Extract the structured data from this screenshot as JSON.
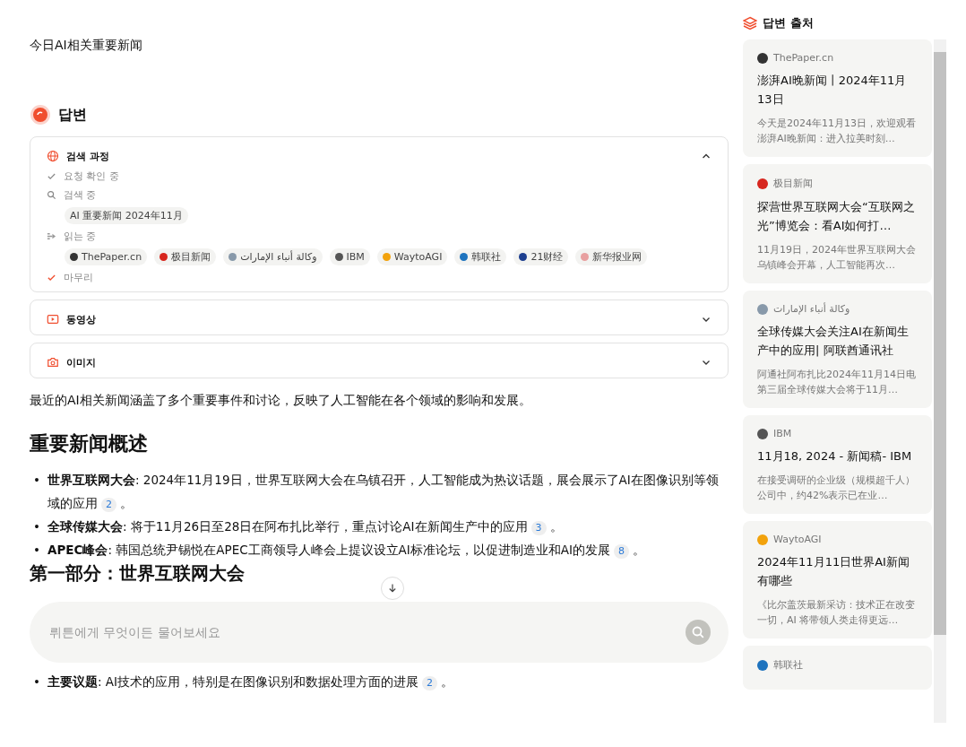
{
  "query": "今日AI相关重要新闻",
  "answer": {
    "title": "답변",
    "panels": [
      {
        "kind": "search",
        "title": "검색 과정",
        "expanded": true,
        "steps": [
          {
            "kind": "check",
            "label": "요청 확인 중"
          },
          {
            "kind": "search",
            "label": "검색 중",
            "chips": [
              {
                "label": "AI 重要新闻 2024年11月"
              }
            ]
          },
          {
            "kind": "read",
            "label": "읽는 중",
            "chips": [
              {
                "label": "ThePaper.cn",
                "color": "#333333"
              },
              {
                "label": "极目新闻",
                "color": "#d7261e"
              },
              {
                "label": "وكالة أنباء الإمارات",
                "color": "#8899aa"
              },
              {
                "label": "IBM",
                "color": "#555555"
              },
              {
                "label": "WaytoAGI",
                "color": "#f2a20c"
              },
              {
                "label": "韩联社",
                "color": "#1e73be"
              },
              {
                "label": "21财经",
                "color": "#1d3f8f"
              },
              {
                "label": "新华报业网",
                "color": "#e8a0a0"
              }
            ]
          },
          {
            "kind": "done",
            "label": "마무리"
          }
        ]
      },
      {
        "kind": "video",
        "title": "동영상",
        "expanded": false
      },
      {
        "kind": "image",
        "title": "이미지",
        "expanded": false
      }
    ],
    "intro": "最近的AI相关新闻涵盖了多个重要事件和讨论，反映了人工智能在各个领域的影响和发展。",
    "heading": "重要新闻概述",
    "bullets": [
      {
        "marker": "•",
        "text": "**世界互联网大会**: 2024年11月19日，世界互联网大会在乌镇召开，人工智能成为热议话题，展会展示了AI在图像识别等领域的应用",
        "cite": "2",
        "end": "。"
      },
      {
        "marker": "•",
        "text": "**全球传媒大会**: 将于11月26日至28日在阿布扎比举行，重点讨论AI在新闻生产中的应用",
        "cite": "3",
        "end": "。"
      },
      {
        "marker": "•",
        "text": "**APEC峰会**: 韩国总统尹锡悦在APEC工商领导人峰会上提议设立AI标准论坛，以促进制造业和AI的发展",
        "cite": "8",
        "end": "。"
      }
    ],
    "heading2": "第一部分：世界互联网大会",
    "bullets2": [
      {
        "marker": "•",
        "text": "**主要议题**: AI技术的应用，特别是在图像识别和数据处理方面的进展",
        "cite": "2",
        "end": "。"
      }
    ]
  },
  "ask": {
    "placeholder": "뤼튼에게 무엇이든 물어보세요"
  },
  "sources": {
    "title": "답변 출처",
    "cards": [
      {
        "source": "ThePaper.cn",
        "color": "#333333",
        "title": "澎湃AI晚新闻丨2024年11月13日",
        "snippet": "今天是2024年11月13日，欢迎观看澎湃AI晚新闻：进入拉美时刻…"
      },
      {
        "source": "极目新闻",
        "color": "#d7261e",
        "title": "探营世界互联网大会“互联网之光”博览会：看AI如何打…",
        "snippet": "11月19日，2024年世界互联网大会乌镇峰会开幕，人工智能再次…"
      },
      {
        "source": "وكالة أنباء الإمارات",
        "color": "#8899aa",
        "title": "全球传媒大会关注AI在新闻生产中的应用| 阿联酋通讯社",
        "snippet": "阿通社阿布扎比2024年11月14日电第三届全球传媒大会将于11月…"
      },
      {
        "source": "IBM",
        "color": "#555555",
        "title": "11月18, 2024 - 新闻稿- IBM",
        "snippet": "在接受调研的企业级（规模超千人）公司中，约42%表示已在业…"
      },
      {
        "source": "WaytoAGI",
        "color": "#f2a20c",
        "title": "2024年11月11日世界AI新闻有哪些",
        "snippet": "《比尔盖茨最新采访：技术正在改变一切，AI 将带领人类走得更远…"
      },
      {
        "source": "韩联社",
        "color": "#1e73be"
      }
    ]
  }
}
